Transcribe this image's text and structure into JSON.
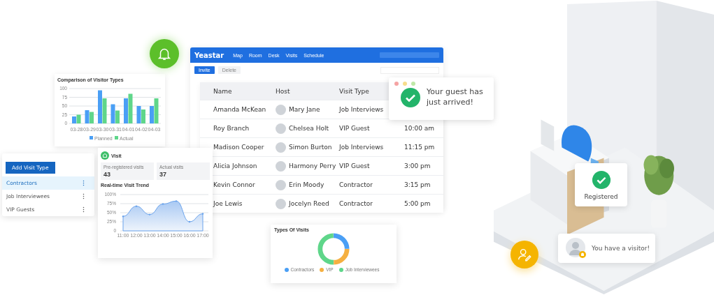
{
  "app_window": {
    "brand": "Yeastar",
    "nav": [
      {
        "label": "Map"
      },
      {
        "label": "Room"
      },
      {
        "label": "Desk"
      },
      {
        "label": "Visits"
      },
      {
        "label": "Schedule"
      }
    ],
    "buttons": [
      {
        "label": "Invite",
        "kind": "primary"
      },
      {
        "label": "Delete",
        "kind": "secondary"
      }
    ]
  },
  "visitor_table": {
    "columns": [
      "Name",
      "Host",
      "Visit Type"
    ],
    "rows": [
      {
        "name": "Amanda McKean",
        "host": "Mary Jane",
        "visit_type": "Job Interviews"
      },
      {
        "name": "Roy Branch",
        "host": "Chelsea Holt",
        "visit_type": "VIP Guest",
        "time": "10:00 am"
      },
      {
        "name": "Madison Cooper",
        "host": "Simon Burton",
        "visit_type": "Job Interviews",
        "time": "11:15 pm"
      },
      {
        "name": "Alicia Johnson",
        "host": "Harmony Perry",
        "visit_type": "VIP Guest",
        "time": "3:00 pm"
      },
      {
        "name": "Kevin Connor",
        "host": "Erin Moody",
        "visit_type": "Contractor",
        "time": "3:15 pm"
      },
      {
        "name": "Joe Lewis",
        "host": "Jocelyn Reed",
        "visit_type": "Contractor",
        "time": "5:00 pm"
      }
    ]
  },
  "arrival_notification": {
    "text": "Your guest has just arrived!"
  },
  "visitor_types_chart": {
    "title": "Comparison of Visitor Types",
    "chart_data": {
      "type": "bar",
      "categories": [
        "03-28",
        "03-29",
        "03-30",
        "03-31",
        "04-01",
        "04-02",
        "04-03"
      ],
      "series": [
        {
          "name": "Planned",
          "color": "#4a9ff5",
          "values": [
            20,
            38,
            95,
            55,
            72,
            50,
            50
          ]
        },
        {
          "name": "Actual",
          "color": "#5fd68a",
          "values": [
            25,
            33,
            72,
            37,
            85,
            40,
            72
          ]
        }
      ],
      "ylim": [
        0,
        100
      ],
      "yticks": [
        0,
        25,
        50,
        75,
        100
      ],
      "grid": true,
      "legend": true
    }
  },
  "visit_types_panel": {
    "button": "Add Visit Type",
    "items": [
      {
        "label": "Contractors",
        "selected": true
      },
      {
        "label": "Job Interviewees",
        "selected": false
      },
      {
        "label": "VIP Guests",
        "selected": false
      }
    ]
  },
  "visit_card": {
    "title": "Visit",
    "stats": [
      {
        "label": "Pre-registered visits",
        "value": "43"
      },
      {
        "label": "Actual visits",
        "value": "37"
      }
    ],
    "trend_title": "Real-time Visit Trend",
    "chart_data": {
      "type": "area",
      "x": [
        "11:00",
        "12:00",
        "13:00",
        "14:00",
        "15:00",
        "16:00",
        "17:00"
      ],
      "values": [
        40,
        68,
        45,
        74,
        82,
        25,
        47
      ],
      "ylim": [
        0,
        100
      ],
      "grid": true,
      "yticks": [
        0,
        {
          "value": 25,
          "label": "25%"
        },
        {
          "value": 50,
          "label": "50%"
        },
        {
          "value": 75,
          "label": "75%"
        },
        {
          "value": 100,
          "label": "100%"
        }
      ]
    }
  },
  "visits_types_card": {
    "title": "Types Of Visits",
    "legend": [
      {
        "label": "Contractors",
        "color": "#4a9ff5"
      },
      {
        "label": "VIP",
        "color": "#f5b041"
      },
      {
        "label": "Job Interviewees",
        "color": "#5fd68a"
      }
    ]
  },
  "registered_bubble": {
    "text": "Registered"
  },
  "visitor_bubble": {
    "text": "You have a visitor!"
  }
}
